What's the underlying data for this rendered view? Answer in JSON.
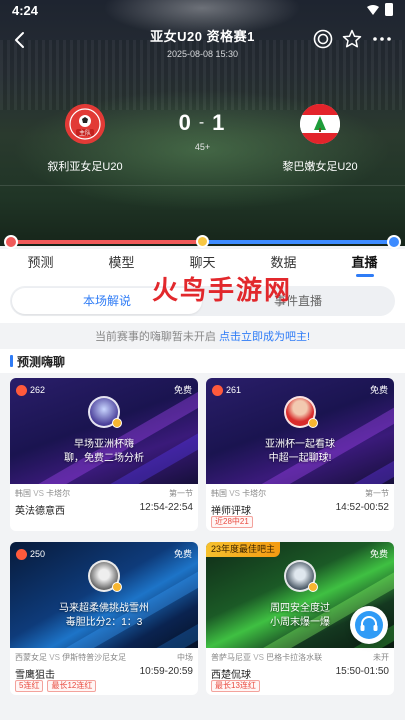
{
  "status_bar": {
    "time": "4:24"
  },
  "header": {
    "title": "亚女U20  资格赛1",
    "date": "2025-08-08 15:30"
  },
  "match": {
    "home": {
      "name": "叙利亚女足U20",
      "badge_text": "主队"
    },
    "away": {
      "name": "黎巴嫩女足U20"
    },
    "home_score": "0",
    "away_score": "1",
    "minute": "45+"
  },
  "tabs": [
    "预测",
    "模型",
    "聊天",
    "数据",
    "直播"
  ],
  "active_tab": "直播",
  "segments": {
    "left": "本场解说",
    "right": "事件直播"
  },
  "watermark": "火鸟手游网",
  "notice": {
    "text": "当前赛事的嗨聊暂未开启 ",
    "link": "点击立即成为吧主!"
  },
  "section_title": "预测嗨聊",
  "cards": [
    {
      "hot": "262",
      "free": "免费",
      "caption": "早场亚洲杯嗨\n聊，免费二场分析",
      "league": "韩国",
      "vs": "VS",
      "opponent": "卡塔尔",
      "stage": "第一节",
      "host": "英法德意西",
      "time": "12:54-22:54",
      "tags": []
    },
    {
      "hot": "261",
      "free": "免费",
      "caption": "亚洲杯一起看球\n中超一起聊球!",
      "league": "韩国",
      "vs": "VS",
      "opponent": "卡塔尔",
      "stage": "第一节",
      "host": "禅师评球",
      "time": "14:52-00:52",
      "tags": [
        "近28中21"
      ]
    },
    {
      "hot": "250",
      "free": "免费",
      "caption": "马来超柔佛挑战雪州\n毒胆比分2：1：3",
      "league": "西蒙女足",
      "vs": "VS",
      "opponent": "伊斯特普沙尼女足",
      "stage": "中场",
      "host": "雪鹰狙击",
      "time": "10:59-20:59",
      "tags": [
        "5连红",
        "最长12连红"
      ]
    },
    {
      "award": "23年度最佳吧主",
      "free": "免费",
      "caption": "周四安全度过\n小周末爆一爆",
      "league": "普萨马尼亚",
      "vs": "VS",
      "opponent": "巴格卡拉洛水联",
      "stage": "未开",
      "host": "西楚侃球",
      "time": "15:50-01:50",
      "tags": [
        "最长13连红"
      ]
    }
  ],
  "colors": {
    "accent": "#2f7cf6",
    "home": "#f05a5a",
    "away": "#3d8bff",
    "tag": "#e94a3f"
  }
}
